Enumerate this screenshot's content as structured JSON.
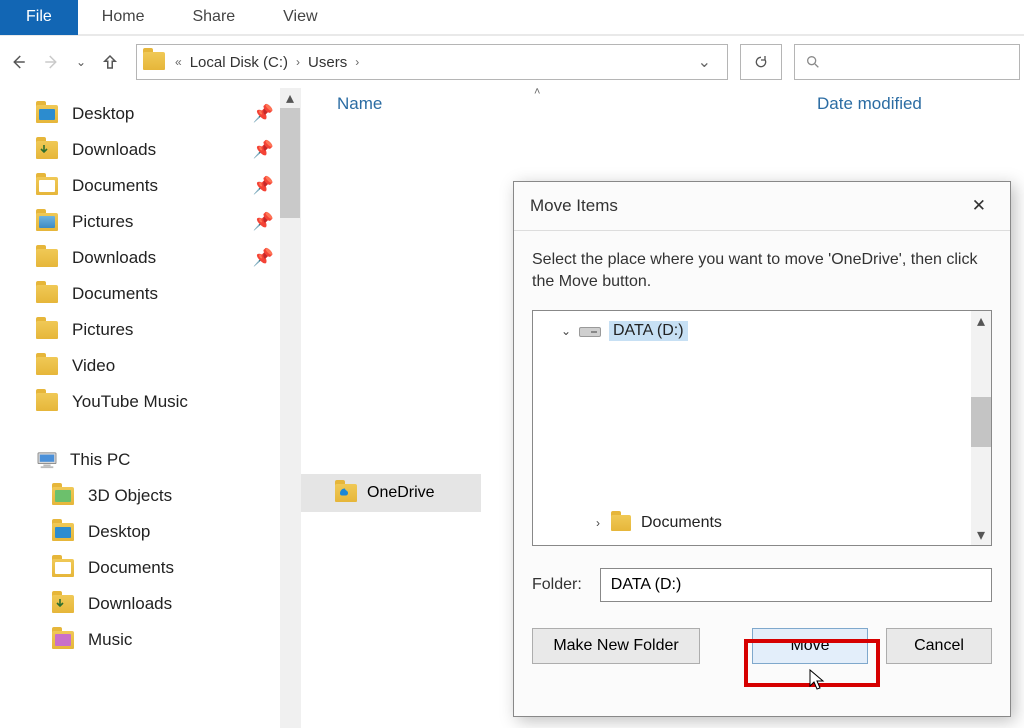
{
  "ribbon": {
    "file": "File",
    "home": "Home",
    "share": "Share",
    "view": "View"
  },
  "address": {
    "part1": "Local Disk (C:)",
    "part2": "Users"
  },
  "columns": {
    "name": "Name",
    "date": "Date modified"
  },
  "sidebar": {
    "quick": [
      {
        "label": "Desktop",
        "icon": "desktop",
        "pinned": true
      },
      {
        "label": "Downloads",
        "icon": "download",
        "pinned": true
      },
      {
        "label": "Documents",
        "icon": "doc",
        "pinned": true
      },
      {
        "label": "Pictures",
        "icon": "pic",
        "pinned": true
      },
      {
        "label": "Downloads",
        "icon": "plain",
        "pinned": true
      },
      {
        "label": "Documents",
        "icon": "plain",
        "pinned": false
      },
      {
        "label": "Pictures",
        "icon": "plain",
        "pinned": false
      },
      {
        "label": "Video",
        "icon": "plain",
        "pinned": false
      },
      {
        "label": "YouTube Music",
        "icon": "plain",
        "pinned": false
      }
    ],
    "thispc_label": "This PC",
    "thispc": [
      {
        "label": "3D Objects"
      },
      {
        "label": "Desktop"
      },
      {
        "label": "Documents"
      },
      {
        "label": "Downloads"
      },
      {
        "label": "Music"
      }
    ]
  },
  "filelist": {
    "item": "OneDrive"
  },
  "dialog": {
    "title": "Move Items",
    "message": "Select the place where you want to move 'OneDrive', then click the Move button.",
    "tree_selected": "DATA (D:)",
    "tree_child": "Documents",
    "folder_label": "Folder:",
    "folder_value": "DATA (D:)",
    "btn_newfolder": "Make New Folder",
    "btn_move": "Move",
    "btn_cancel": "Cancel"
  }
}
